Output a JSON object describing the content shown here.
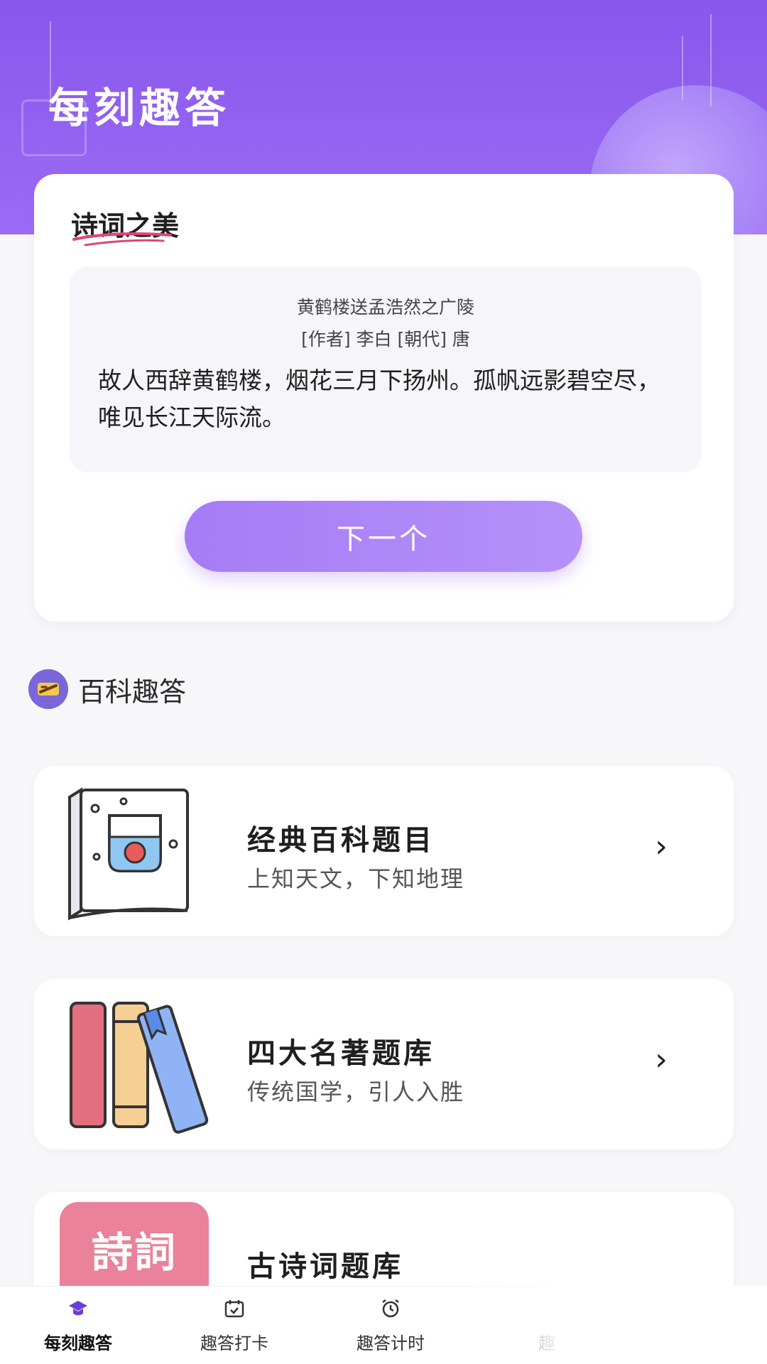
{
  "app": {
    "title": "每刻趣答"
  },
  "poem_section": {
    "heading": "诗词之美",
    "poem_title": "黄鹤楼送孟浩然之广陵",
    "poem_meta": "[作者] 李白 [朝代] 唐",
    "poem_text": "故人西辞黄鹤楼，烟花三月下扬州。孤帆远影碧空尽，唯见长江天际流。",
    "next_label": "下一个"
  },
  "wiki_section": {
    "title": "百科趣答",
    "items": [
      {
        "title": "经典百科题目",
        "subtitle": "上知天文，下知地理",
        "icon": "glass-book-icon"
      },
      {
        "title": "四大名著题库",
        "subtitle": "传统国学，引人入胜",
        "icon": "books-icon"
      },
      {
        "title": "古诗词题库",
        "subtitle": "",
        "icon": "poetry-book-icon",
        "icon_text": "詩詞"
      }
    ]
  },
  "bottom_nav": {
    "items": [
      {
        "label": "每刻趣答",
        "icon": "graduation-cap-icon",
        "active": true
      },
      {
        "label": "趣答打卡",
        "icon": "calendar-check-icon",
        "active": false
      },
      {
        "label": "趣答计时",
        "icon": "alarm-clock-icon",
        "active": false
      },
      {
        "label": "趣",
        "icon": "more-icon",
        "active": false
      }
    ]
  },
  "colors": {
    "header": "#8a56ec",
    "button": "#a67cf6",
    "background": "#f7f7f9"
  }
}
